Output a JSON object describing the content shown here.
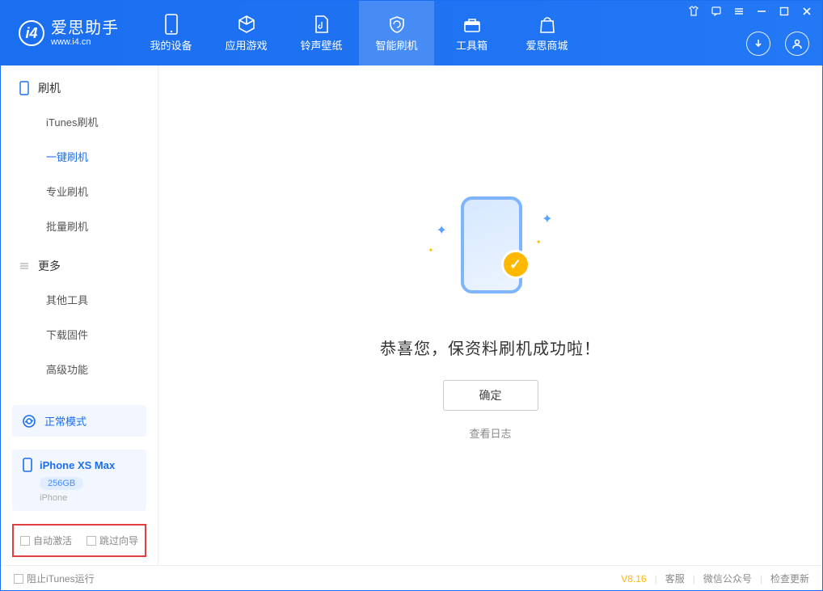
{
  "app": {
    "title": "爱思助手",
    "subtitle": "www.i4.cn"
  },
  "nav": [
    {
      "label": "我的设备"
    },
    {
      "label": "应用游戏"
    },
    {
      "label": "铃声壁纸"
    },
    {
      "label": "智能刷机"
    },
    {
      "label": "工具箱"
    },
    {
      "label": "爱思商城"
    }
  ],
  "sidebar": {
    "section1_title": "刷机",
    "items1": [
      {
        "label": "iTunes刷机"
      },
      {
        "label": "一键刷机"
      },
      {
        "label": "专业刷机"
      },
      {
        "label": "批量刷机"
      }
    ],
    "section2_title": "更多",
    "items2": [
      {
        "label": "其他工具"
      },
      {
        "label": "下载固件"
      },
      {
        "label": "高级功能"
      }
    ]
  },
  "mode": {
    "label": "正常模式"
  },
  "device": {
    "name": "iPhone XS Max",
    "capacity": "256GB",
    "type": "iPhone"
  },
  "options": {
    "auto_activate": "自动激活",
    "skip_guide": "跳过向导"
  },
  "main": {
    "success_message": "恭喜您，保资料刷机成功啦！",
    "ok_button": "确定",
    "view_log": "查看日志"
  },
  "footer": {
    "block_itunes": "阻止iTunes运行",
    "version": "V8.16",
    "service": "客服",
    "wechat": "微信公众号",
    "check_update": "检查更新"
  }
}
